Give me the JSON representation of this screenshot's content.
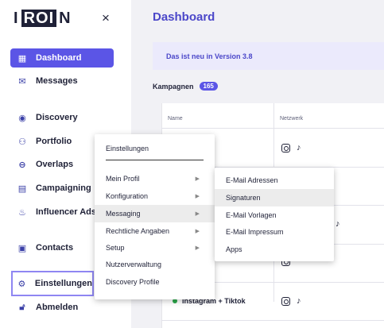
{
  "logo": {
    "left": "I",
    "box": "ROI",
    "right": "N"
  },
  "close_icon": "×",
  "sidebar": {
    "items": [
      {
        "label": "Dashboard",
        "icon": "dashboard-icon",
        "glyph": "▦"
      },
      {
        "label": "Messages",
        "icon": "mail-icon",
        "glyph": "✉"
      },
      {
        "label": "Discovery",
        "icon": "eye-icon",
        "glyph": "◉"
      },
      {
        "label": "Portfolio",
        "icon": "users-icon",
        "glyph": "⚇"
      },
      {
        "label": "Overlaps",
        "icon": "overlap-icon",
        "glyph": "⊖"
      },
      {
        "label": "Campaigning",
        "icon": "document-icon",
        "glyph": "▤"
      },
      {
        "label": "Influencer Ads",
        "icon": "flame-icon",
        "glyph": "♨"
      },
      {
        "label": "Contacts",
        "icon": "contact-icon",
        "glyph": "▣"
      },
      {
        "label": "Einstellungen",
        "icon": "gear-icon",
        "glyph": "⚙"
      },
      {
        "label": "Abmelden",
        "icon": "lock-icon",
        "glyph": "🔓︎"
      }
    ]
  },
  "main": {
    "title": "Dashboard",
    "banner": "Das ist neu in Version 3.8",
    "section": {
      "label": "Kampagnen",
      "count": "165"
    },
    "table": {
      "headers": [
        "Name",
        "Netzwerk"
      ],
      "partial_text": "m",
      "last_row_name": "Instagram + Tiktok"
    }
  },
  "context_menu": {
    "header": "Einstellungen",
    "items": [
      {
        "label": "Mein Profil",
        "submenu": true
      },
      {
        "label": "Konfiguration",
        "submenu": true
      },
      {
        "label": "Messaging",
        "submenu": true
      },
      {
        "label": "Rechtliche Angaben",
        "submenu": true
      },
      {
        "label": "Setup",
        "submenu": true
      },
      {
        "label": "Nutzerverwaltung",
        "submenu": false
      },
      {
        "label": "Discovery Profile",
        "submenu": false
      }
    ],
    "arrow": "▶"
  },
  "submenu": {
    "items": [
      {
        "label": "E-Mail Adressen"
      },
      {
        "label": "Signaturen"
      },
      {
        "label": "E-Mail Vorlagen"
      },
      {
        "label": "E-Mail Impressum"
      },
      {
        "label": "Apps"
      }
    ]
  },
  "colors": {
    "accent": "#5b55e6",
    "title": "#4b47c9",
    "banner_bg": "#ebeafc",
    "status_green": "#2ba84a"
  }
}
